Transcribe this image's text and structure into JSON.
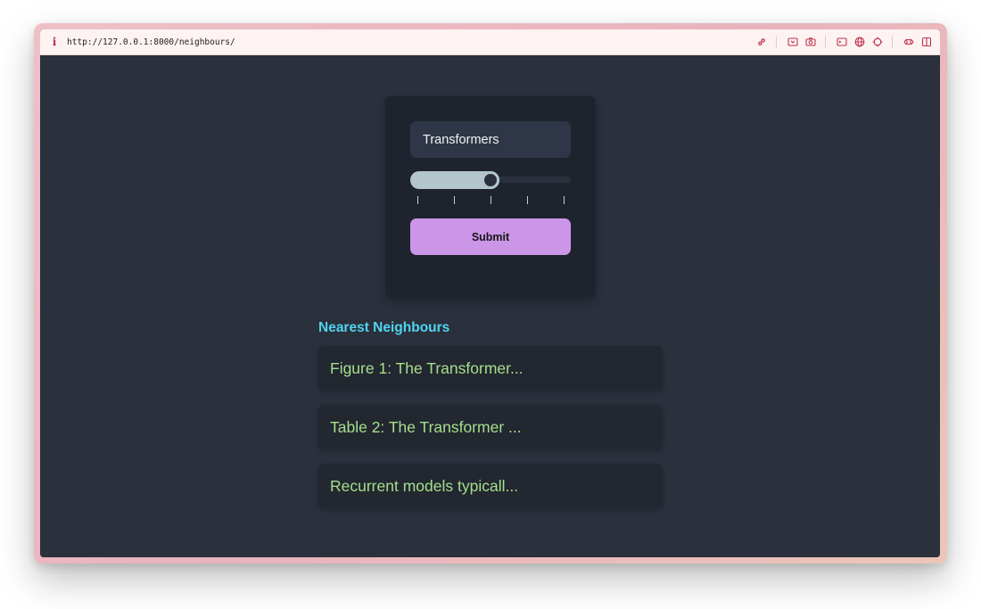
{
  "browser": {
    "url": "http://127.0.0.1:8000/neighbours/"
  },
  "form": {
    "query_value": "Transformers",
    "slider_value": 0.5,
    "slider_tick_count": 5,
    "submit_label": "Submit"
  },
  "results": {
    "title": "Nearest Neighbours",
    "items": [
      "Figure 1: The Transformer...",
      "Table 2: The Transformer ...",
      "Recurrent models typicall..."
    ]
  },
  "icons": [
    "info-icon",
    "link-icon",
    "screenshot-icon",
    "camera-icon",
    "terminal-icon",
    "globe-icon",
    "crosshair-icon",
    "responsive-icon",
    "split-view-icon"
  ],
  "colors": {
    "page_background": "#2a303c",
    "card_background": "#1f232d",
    "input_background": "#2f3647",
    "slider_fill": "#b3c6cc",
    "submit_background": "#cb96e8",
    "results_title": "#4fd4ef",
    "result_text": "#a5df8d",
    "toolbar_icons": "#c0304a"
  }
}
